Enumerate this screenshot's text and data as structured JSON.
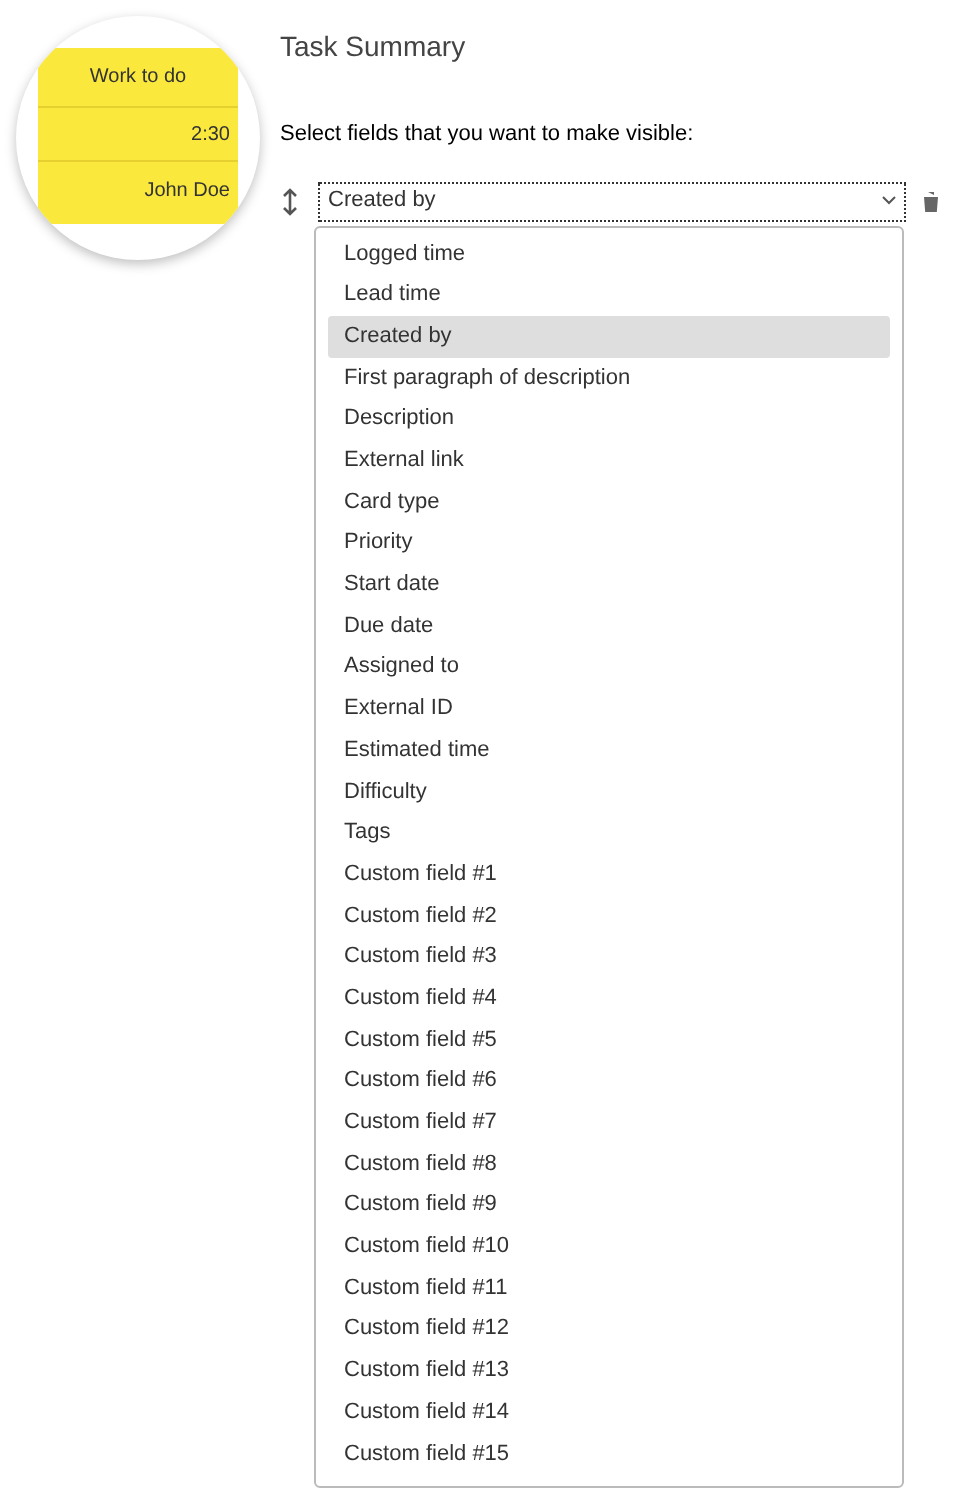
{
  "preview": {
    "title": "Work to do",
    "time": "2:30",
    "assignee": "John Doe"
  },
  "heading": "Task Summary",
  "instruction": "Select fields that you want to make visible:",
  "select": {
    "value": "Created by",
    "expanded": true
  },
  "options": [
    {
      "label": "Logged time",
      "selected": false
    },
    {
      "label": "Lead time",
      "selected": false
    },
    {
      "label": "Created by",
      "selected": true
    },
    {
      "label": "First paragraph of description",
      "selected": false
    },
    {
      "label": "Description",
      "selected": false
    },
    {
      "label": "External link",
      "selected": false
    },
    {
      "label": "Card type",
      "selected": false
    },
    {
      "label": "Priority",
      "selected": false
    },
    {
      "label": "Start date",
      "selected": false
    },
    {
      "label": "Due date",
      "selected": false
    },
    {
      "label": "Assigned to",
      "selected": false
    },
    {
      "label": "External ID",
      "selected": false
    },
    {
      "label": "Estimated time",
      "selected": false
    },
    {
      "label": "Difficulty",
      "selected": false
    },
    {
      "label": "Tags",
      "selected": false
    },
    {
      "label": "Custom field #1",
      "selected": false
    },
    {
      "label": "Custom field #2",
      "selected": false
    },
    {
      "label": "Custom field #3",
      "selected": false
    },
    {
      "label": "Custom field #4",
      "selected": false
    },
    {
      "label": "Custom field #5",
      "selected": false
    },
    {
      "label": "Custom field #6",
      "selected": false
    },
    {
      "label": "Custom field #7",
      "selected": false
    },
    {
      "label": "Custom field #8",
      "selected": false
    },
    {
      "label": "Custom field #9",
      "selected": false
    },
    {
      "label": "Custom field #10",
      "selected": false
    },
    {
      "label": "Custom field #11",
      "selected": false
    },
    {
      "label": "Custom field #12",
      "selected": false
    },
    {
      "label": "Custom field #13",
      "selected": false
    },
    {
      "label": "Custom field #14",
      "selected": false
    },
    {
      "label": "Custom field #15",
      "selected": false
    }
  ]
}
